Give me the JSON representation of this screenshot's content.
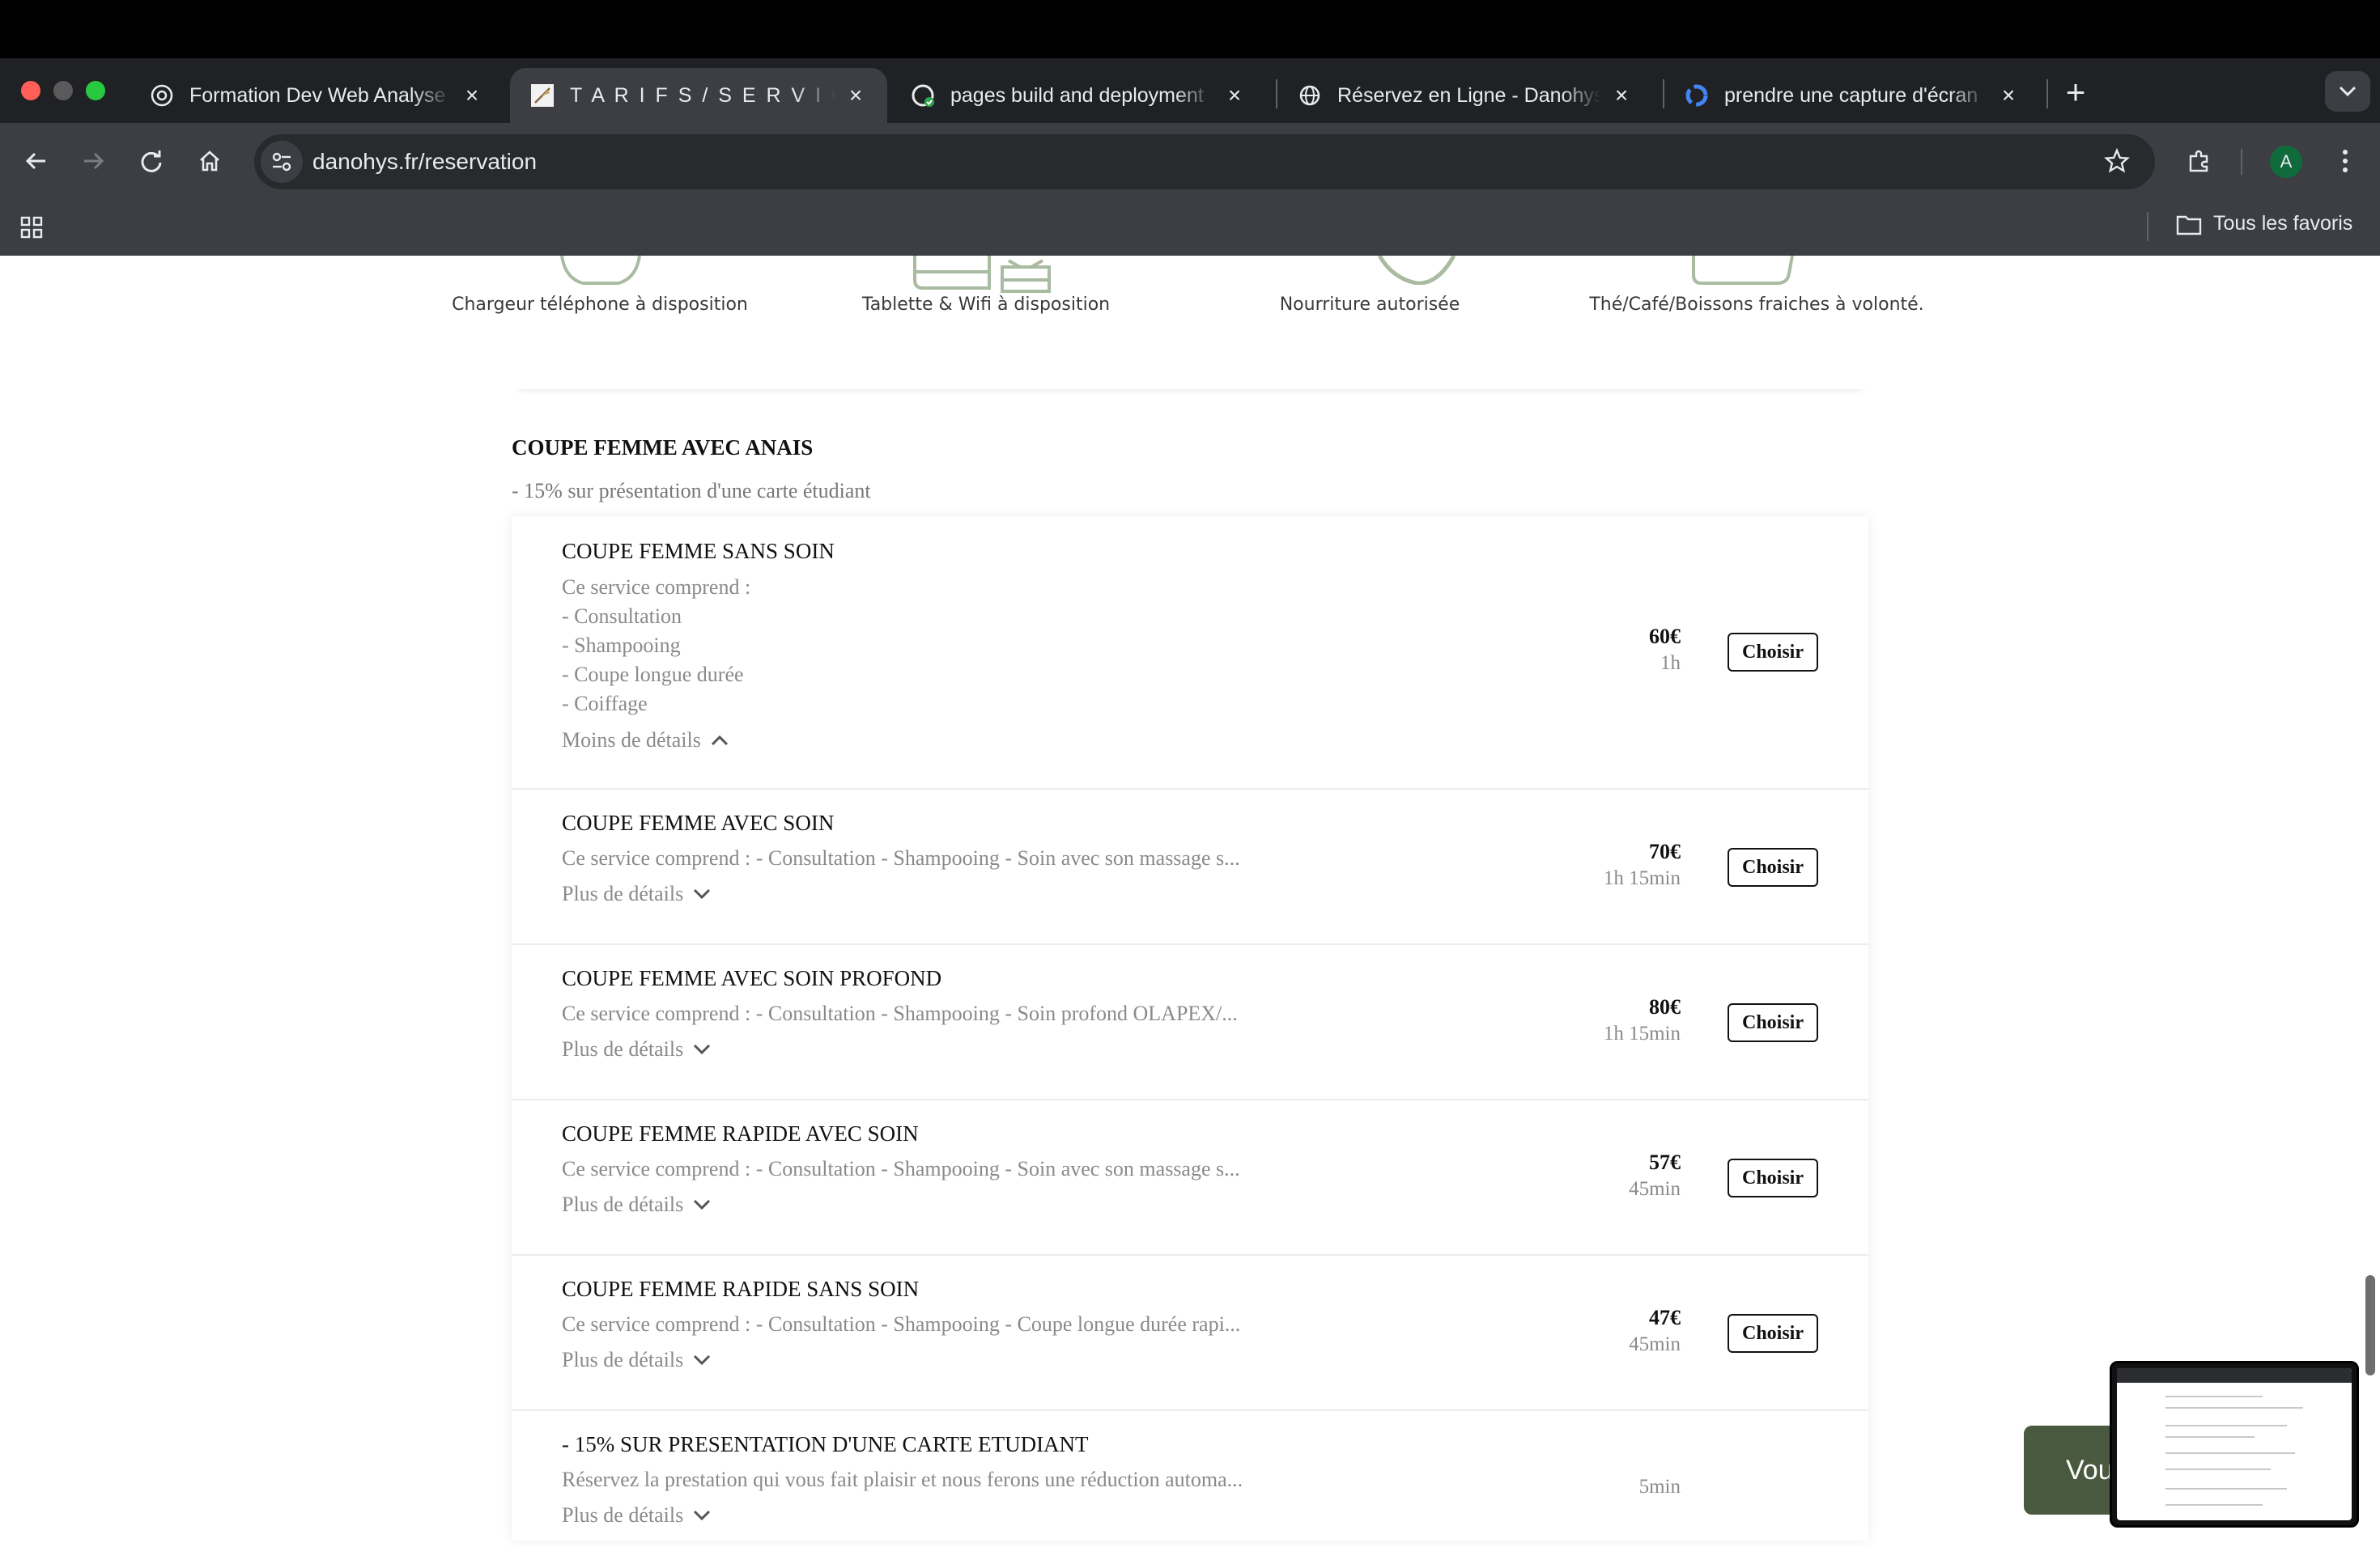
{
  "browser": {
    "tabs": [
      {
        "title": "Formation Dev Web Analyse",
        "icon": "openai-icon",
        "active": false
      },
      {
        "title": "T A R I F S / S E R V I C E S | D",
        "icon": "site-feather-icon",
        "active": true
      },
      {
        "title": "pages build and deployment ·",
        "icon": "github-icon",
        "active": false
      },
      {
        "title": "Réservez en Ligne - Danohys",
        "icon": "globe-icon",
        "active": false
      },
      {
        "title": "prendre une capture d'écran",
        "icon": "google-icon",
        "active": false
      }
    ],
    "url": "danohys.fr/reservation",
    "profile_initial": "A",
    "bookmarks_folder": "Tous les favoris"
  },
  "amenities": [
    {
      "label": "Chargeur téléphone à disposition"
    },
    {
      "label": "Tablette & Wifi à disposition"
    },
    {
      "label": "Nourriture autorisée"
    },
    {
      "label": "Thé/Café/Boissons fraiches à volonté."
    }
  ],
  "section": {
    "title": "COUPE FEMME AVEC ANAIS",
    "subtitle": "- 15% sur présentation d'une carte étudiant"
  },
  "services": [
    {
      "name": "COUPE FEMME SANS SOIN",
      "desc_lines": [
        "Ce service comprend :",
        "- Consultation",
        "- Shampooing",
        "- Coupe longue durée",
        "- Coiffage"
      ],
      "toggle": "Moins de détails",
      "price": "60€",
      "duration": "1h",
      "button": "Choisir"
    },
    {
      "name": "COUPE FEMME AVEC SOIN",
      "desc": "Ce service comprend : - Consultation - Shampooing - Soin avec son massage s...",
      "toggle": "Plus de détails",
      "price": "70€",
      "duration": "1h 15min",
      "button": "Choisir"
    },
    {
      "name": "COUPE FEMME AVEC SOIN PROFOND",
      "desc": "Ce service comprend : - Consultation - Shampooing - Soin profond OLAPEX/...",
      "toggle": "Plus de détails",
      "price": "80€",
      "duration": "1h 15min",
      "button": "Choisir"
    },
    {
      "name": "COUPE FEMME RAPIDE AVEC SOIN",
      "desc": "Ce service comprend : - Consultation - Shampooing - Soin avec son massage s...",
      "toggle": "Plus de détails",
      "price": "57€",
      "duration": "45min",
      "button": "Choisir"
    },
    {
      "name": "COUPE FEMME RAPIDE SANS SOIN",
      "desc": "Ce service comprend : - Consultation - Shampooing - Coupe longue durée rapi...",
      "toggle": "Plus de détails",
      "price": "47€",
      "duration": "45min",
      "button": "Choisir"
    },
    {
      "name": "- 15% SUR PRESENTATION D'UNE CARTE ETUDIANT",
      "desc": "Réservez la prestation qui vous fait plaisir et nous ferons une réduction automa...",
      "toggle": "Plus de détails",
      "duration": "5min"
    }
  ],
  "cta": {
    "label": "Vous"
  },
  "colors": {
    "accent_green": "#4a5a40",
    "icon_green": "#a9bba0",
    "chrome_dark": "#202124"
  }
}
